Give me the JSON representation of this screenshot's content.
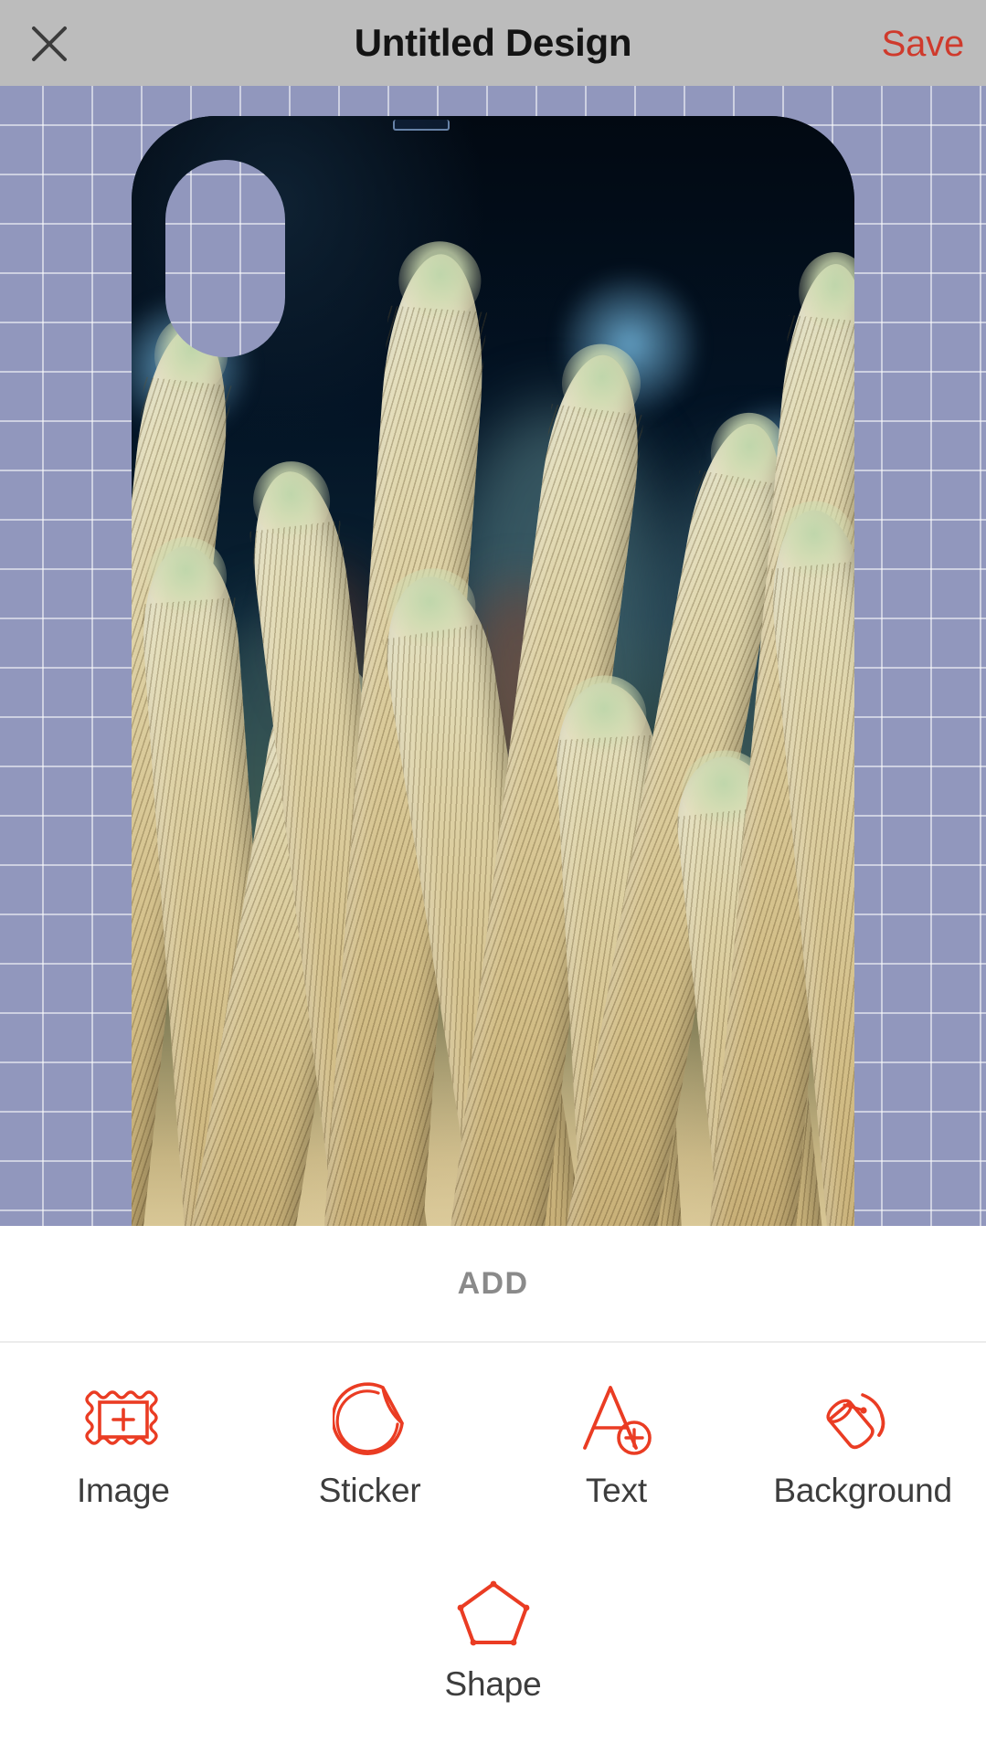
{
  "header": {
    "close_icon": "close-x-icon",
    "title": "Untitled Design",
    "save_label": "Save"
  },
  "canvas": {
    "background_color": "#9197bd",
    "grid_line_color": "#ffffff",
    "artboard": {
      "name": "phone-case-artboard",
      "shape": "phone-case",
      "artwork_description": "Sea anemone tentacles photo on dark navy background",
      "camera_cutout": "pill-shaped camera cutout"
    }
  },
  "panel": {
    "section_title": "ADD",
    "tools_row_1": [
      {
        "label": "Image",
        "icon": "image-frame-plus-icon"
      },
      {
        "label": "Sticker",
        "icon": "sticker-peel-icon"
      },
      {
        "label": "Text",
        "icon": "text-a-plus-icon"
      },
      {
        "label": "Background",
        "icon": "paint-bucket-icon"
      }
    ],
    "tools_row_2": [
      {
        "label": "Shape",
        "icon": "pentagon-shape-icon"
      }
    ]
  },
  "colors": {
    "accent_red": "#ea3c23",
    "save_red": "#cf3a2c",
    "header_grey": "#bcbcbc",
    "label_grey": "#8a8a8a",
    "text_dark": "#3d3d3d"
  }
}
